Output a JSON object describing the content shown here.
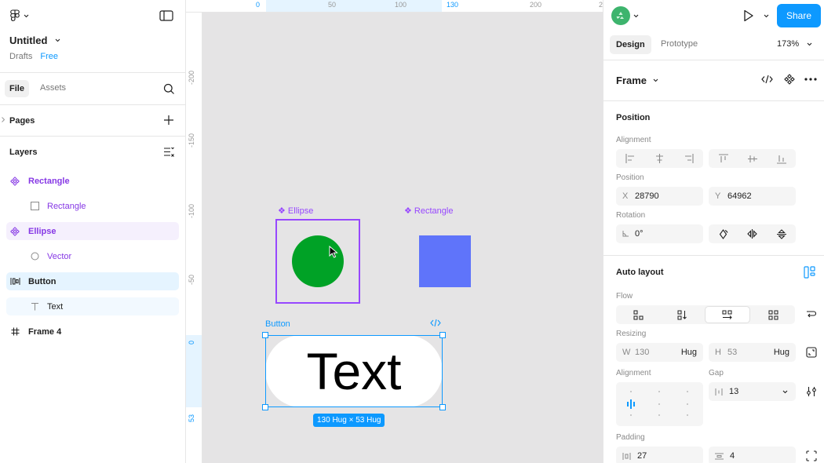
{
  "file": {
    "title": "Untitled",
    "location": "Drafts",
    "plan": "Free"
  },
  "left_tabs": {
    "file": "File",
    "assets": "Assets"
  },
  "pages_label": "Pages",
  "layers_label": "Layers",
  "layers": [
    {
      "name": "Rectangle",
      "type": "component"
    },
    {
      "name": "Rectangle",
      "type": "rectangle"
    },
    {
      "name": "Ellipse",
      "type": "component"
    },
    {
      "name": "Vector",
      "type": "ellipse"
    },
    {
      "name": "Button",
      "type": "auto-layout"
    },
    {
      "name": "Text",
      "type": "text"
    },
    {
      "name": "Frame 4",
      "type": "frame"
    }
  ],
  "ruler_top": [
    "0",
    "50",
    "100",
    "130",
    "200",
    "2"
  ],
  "ruler_left": [
    "-200",
    "-150",
    "-100",
    "-50",
    "0",
    "53"
  ],
  "canvas": {
    "ellipse_label": "❖ Ellipse",
    "rectangle_label": "❖ Rectangle",
    "button_label": "Button",
    "button_text": "Text",
    "size_badge": "130 Hug × 53 Hug",
    "ellipse_color": "#00a226",
    "rect_color": "#5f74fa",
    "selection_color": "#0d99ff",
    "component_color": "#9747ff"
  },
  "toolbar": {
    "share": "Share",
    "zoom": "173%"
  },
  "right_tabs": {
    "design": "Design",
    "prototype": "Prototype"
  },
  "frame_label": "Frame",
  "position": {
    "title": "Position",
    "alignment_label": "Alignment",
    "position_label": "Position",
    "x_label": "X",
    "x": "28790",
    "y_label": "Y",
    "y": "64962",
    "rotation_label": "Rotation",
    "rotation": "0°"
  },
  "auto_layout": {
    "title": "Auto layout",
    "flow_label": "Flow",
    "resizing_label": "Resizing",
    "w_label": "W",
    "w": "130",
    "w_mode": "Hug",
    "h_label": "H",
    "h": "53",
    "h_mode": "Hug",
    "alignment_label": "Alignment",
    "gap_label": "Gap",
    "gap": "13",
    "padding_label": "Padding",
    "padding_h": "27",
    "padding_v": "4"
  }
}
